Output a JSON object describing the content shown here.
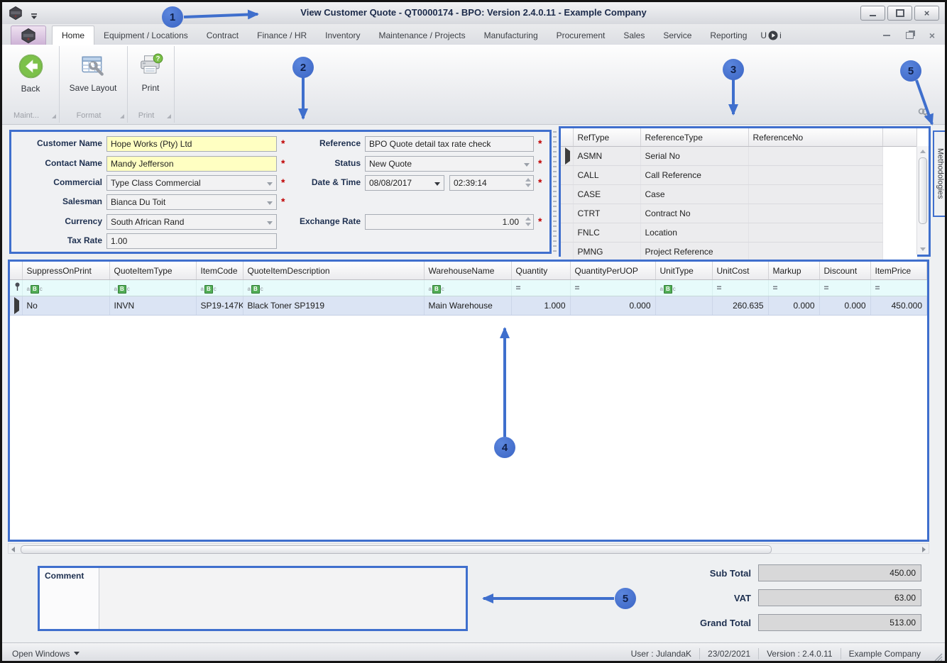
{
  "titlebar": {
    "title": "View Customer Quote - QT0000174 - BPO: Version 2.4.0.11 - Example Company"
  },
  "ribbon": {
    "tabs": [
      "Home",
      "Equipment / Locations",
      "Contract",
      "Finance / HR",
      "Inventory",
      "Maintenance / Projects",
      "Manufacturing",
      "Procurement",
      "Sales",
      "Service",
      "Reporting"
    ],
    "active_tab": "Home",
    "partial_tab": {
      "left": "U",
      "right": "i"
    },
    "buttons": {
      "back": "Back",
      "save_layout": "Save Layout",
      "print": "Print"
    },
    "groups": [
      {
        "label": "Maint..."
      },
      {
        "label": "Format"
      },
      {
        "label": "Print"
      }
    ]
  },
  "form": {
    "required_marker": "*",
    "customer_name": {
      "label": "Customer Name",
      "value": "Hope Works (Pty) Ltd"
    },
    "contact_name": {
      "label": "Contact Name",
      "value": "Mandy Jefferson"
    },
    "commercial": {
      "label": "Commercial",
      "value": "Type Class Commercial"
    },
    "salesman": {
      "label": "Salesman",
      "value": "Bianca Du Toit"
    },
    "currency": {
      "label": "Currency",
      "value": "South African Rand"
    },
    "tax_rate": {
      "label": "Tax Rate",
      "value": "1.00"
    },
    "reference": {
      "label": "Reference",
      "value": "BPO Quote detail tax rate check"
    },
    "status": {
      "label": "Status",
      "value": "New Quote"
    },
    "date_time": {
      "label": "Date & Time",
      "date": "08/08/2017",
      "time": "02:39:14"
    },
    "exchange_rate": {
      "label": "Exchange Rate",
      "value": "1.00"
    }
  },
  "reference_grid": {
    "columns": [
      "RefType",
      "ReferenceType",
      "ReferenceNo"
    ],
    "rows": [
      [
        "ASMN",
        "Serial No",
        ""
      ],
      [
        "CALL",
        "Call Reference",
        ""
      ],
      [
        "CASE",
        "Case",
        ""
      ],
      [
        "CTRT",
        "Contract No",
        ""
      ],
      [
        "FNLC",
        "Location",
        ""
      ],
      [
        "PMNG",
        "Project Reference",
        ""
      ]
    ]
  },
  "side_tab": {
    "label": "Methodologies"
  },
  "items_grid": {
    "columns": [
      "SuppressOnPrint",
      "QuoteItemType",
      "ItemCode",
      "QuoteItemDescription",
      "WarehouseName",
      "Quantity",
      "QuantityPerUOP",
      "UnitType",
      "UnitCost",
      "Markup",
      "Discount",
      "ItemPrice"
    ],
    "filter_ops": {
      "equals": "="
    },
    "rows": [
      [
        "No",
        "INVN",
        "SP19-147K",
        "Black Toner SP1919",
        "Main Warehouse",
        "1.000",
        "0.000",
        "",
        "260.635",
        "0.000",
        "0.000",
        "450.000"
      ]
    ]
  },
  "comment": {
    "label": "Comment",
    "value": ""
  },
  "totals": {
    "sub_total": {
      "label": "Sub Total",
      "value": "450.00"
    },
    "vat": {
      "label": "VAT",
      "value": "63.00"
    },
    "grand_total": {
      "label": "Grand Total",
      "value": "513.00"
    }
  },
  "status_bar": {
    "open_windows": "Open Windows",
    "user": "User : JulandaK",
    "date": "23/02/2021",
    "version": "Version : 2.4.0.11",
    "company": "Example Company"
  },
  "callouts": {
    "c1": "1",
    "c2": "2",
    "c3": "3",
    "c4": "4",
    "c5_top": "5",
    "c5_bottom": "5"
  },
  "icons": {
    "text_filter_a": "a",
    "text_filter_b": "B",
    "text_filter_c": "c",
    "print_badge": "?"
  },
  "colors": {
    "callout_blue": "#3f6fcd",
    "required_red": "#c00000",
    "highlight_yellow": "#ffffc2",
    "selected_row_blue": "#dbe4f4"
  }
}
